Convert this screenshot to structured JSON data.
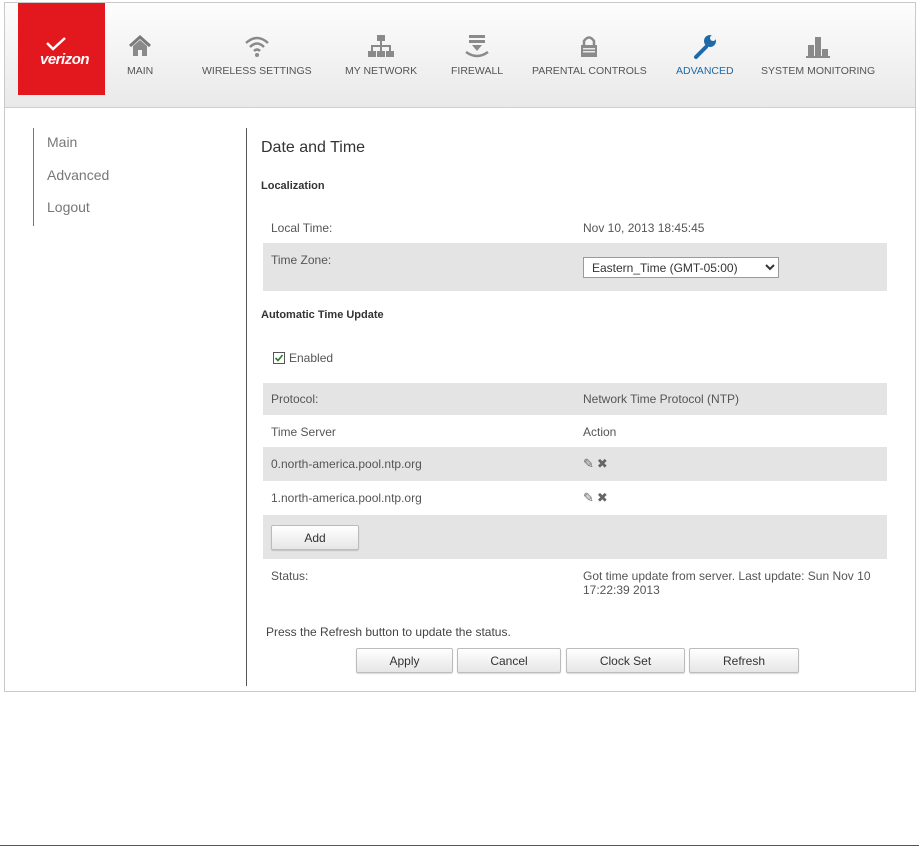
{
  "brand": {
    "logo_text": "verizon",
    "color": "#e3171e"
  },
  "nav": {
    "items": [
      {
        "label": "MAIN",
        "icon": "home-icon"
      },
      {
        "label": "WIRELESS SETTINGS",
        "icon": "wifi-icon"
      },
      {
        "label": "MY NETWORK",
        "icon": "network-icon"
      },
      {
        "label": "FIREWALL",
        "icon": "firewall-icon"
      },
      {
        "label": "PARENTAL CONTROLS",
        "icon": "lock-icon"
      },
      {
        "label": "ADVANCED",
        "icon": "wrench-icon",
        "active": true
      },
      {
        "label": "SYSTEM MONITORING",
        "icon": "bar-chart-icon"
      }
    ],
    "active_color": "#1e6aa8"
  },
  "sidebar": {
    "items": [
      {
        "label": "Main"
      },
      {
        "label": "Advanced"
      },
      {
        "label": "Logout"
      }
    ]
  },
  "page": {
    "title": "Date and Time",
    "localization": {
      "heading": "Localization",
      "local_time_label": "Local Time:",
      "local_time_value": "Nov 10, 2013 18:45:45",
      "time_zone_label": "Time Zone:",
      "time_zone_value": "Eastern_Time (GMT-05:00)"
    },
    "auto_update": {
      "heading": "Automatic Time Update",
      "enabled_label": "Enabled",
      "enabled": true,
      "protocol_label": "Protocol:",
      "protocol_value": "Network Time Protocol (NTP)",
      "server_header": "Time Server",
      "action_header": "Action",
      "servers": [
        "0.north-america.pool.ntp.org",
        "1.north-america.pool.ntp.org"
      ],
      "add_label": "Add",
      "status_label": "Status:",
      "status_value": "Got time update from server. Last update: Sun Nov 10 17:22:39 2013"
    },
    "hint": "Press the Refresh button to update the status.",
    "buttons": {
      "apply": "Apply",
      "cancel": "Cancel",
      "clock_set": "Clock Set",
      "refresh": "Refresh"
    }
  }
}
